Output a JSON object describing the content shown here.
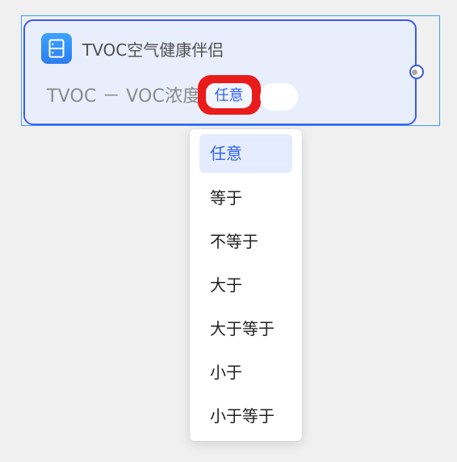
{
  "node": {
    "title": "TVOC空气健康伴侣",
    "icon": "storage-device-icon",
    "condition": {
      "property_label": "TVOC － VOC浓度",
      "operator": "任意",
      "value": ""
    }
  },
  "dropdown": {
    "selected": "任意",
    "options": [
      {
        "label": "任意"
      },
      {
        "label": "等于"
      },
      {
        "label": "不等于"
      },
      {
        "label": "大于"
      },
      {
        "label": "大于等于"
      },
      {
        "label": "小于"
      },
      {
        "label": "小于等于"
      }
    ]
  },
  "colors": {
    "card_border": "#3b5bea",
    "card_background": "#e9eefc",
    "highlight_ring": "#ea1b1b",
    "selected_text": "#2f63f0",
    "selected_background": "#e6ecff",
    "icon_background": "#2f8cf6"
  }
}
